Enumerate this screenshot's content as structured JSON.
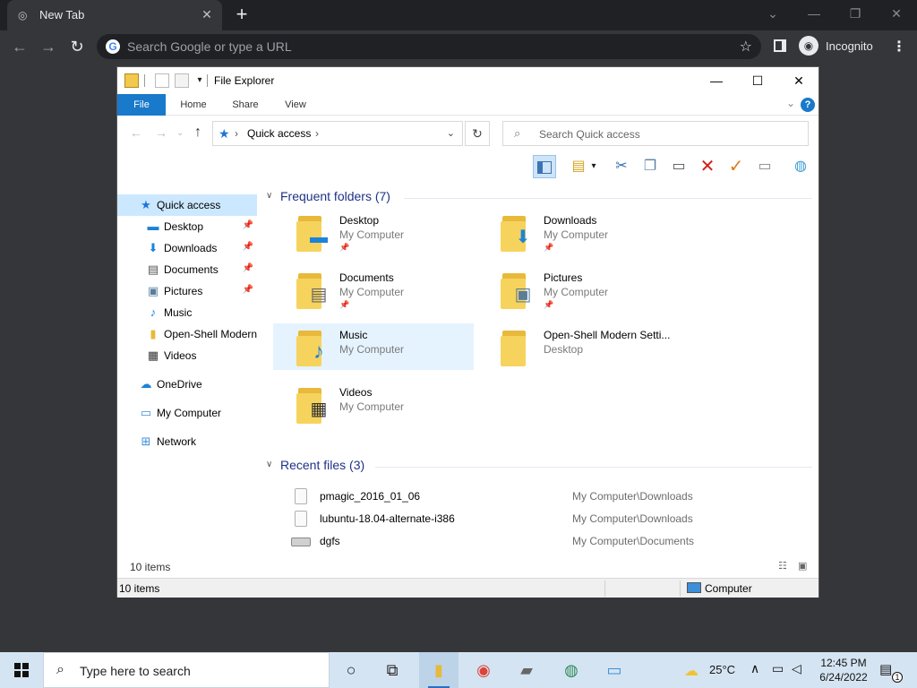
{
  "browser": {
    "tab_title": "New Tab",
    "tab_close": "✕",
    "new_tab": "+",
    "omnibox_placeholder": "Search Google or type a URL",
    "google_glyph": "G",
    "incognito_label": "Incognito",
    "controls": {
      "minimize": "⌄",
      "min2": "—",
      "restore": "❐",
      "close": "✕"
    }
  },
  "explorer": {
    "title": "File Explorer",
    "window_buttons": {
      "minimize": "—",
      "maximize": "☐",
      "close": "✕"
    },
    "ribbon_tabs": [
      "File",
      "Home",
      "Share",
      "View"
    ],
    "help": "?",
    "breadcrumb": [
      "Quick access"
    ],
    "search_placeholder": "Search Quick access",
    "nav_items": [
      {
        "label": "Quick access",
        "icon": "star-icon"
      },
      {
        "label": "Desktop",
        "icon": "desktop-icon"
      },
      {
        "label": "Downloads",
        "icon": "download-icon"
      },
      {
        "label": "Documents",
        "icon": "document-icon"
      },
      {
        "label": "Pictures",
        "icon": "picture-icon"
      },
      {
        "label": "Music",
        "icon": "music-icon"
      },
      {
        "label": "Open-Shell Modern",
        "icon": "folder-icon"
      },
      {
        "label": "Videos",
        "icon": "film-icon"
      },
      {
        "label": "OneDrive",
        "icon": "cloud-icon"
      },
      {
        "label": "My Computer",
        "icon": "computer-icon"
      },
      {
        "label": "Network",
        "icon": "network-icon"
      }
    ],
    "frequent_header": "Frequent folders (7)",
    "frequent": [
      {
        "name": "Desktop",
        "sub": "My Computer",
        "pinned": true
      },
      {
        "name": "Downloads",
        "sub": "My Computer",
        "pinned": true
      },
      {
        "name": "Documents",
        "sub": "My Computer",
        "pinned": true
      },
      {
        "name": "Pictures",
        "sub": "My Computer",
        "pinned": true
      },
      {
        "name": "Music",
        "sub": "My Computer",
        "pinned": false
      },
      {
        "name": "Open-Shell Modern Setti...",
        "sub": "Desktop",
        "pinned": false
      },
      {
        "name": "Videos",
        "sub": "My Computer",
        "pinned": false
      }
    ],
    "recent_header": "Recent files (3)",
    "recent": [
      {
        "name": "pmagic_2016_01_06",
        "path": "My Computer\\Downloads"
      },
      {
        "name": "lubuntu-18.04-alternate-i386",
        "path": "My Computer\\Downloads"
      },
      {
        "name": "dgfs",
        "path": "My Computer\\Documents"
      }
    ],
    "item_count": "10 items",
    "status_left": "10 items",
    "status_right": "Computer"
  },
  "taskbar": {
    "search_placeholder": "Type here to search",
    "weather": "25°C",
    "time": "12:45 PM",
    "date": "6/24/2022",
    "notifications": "1"
  }
}
